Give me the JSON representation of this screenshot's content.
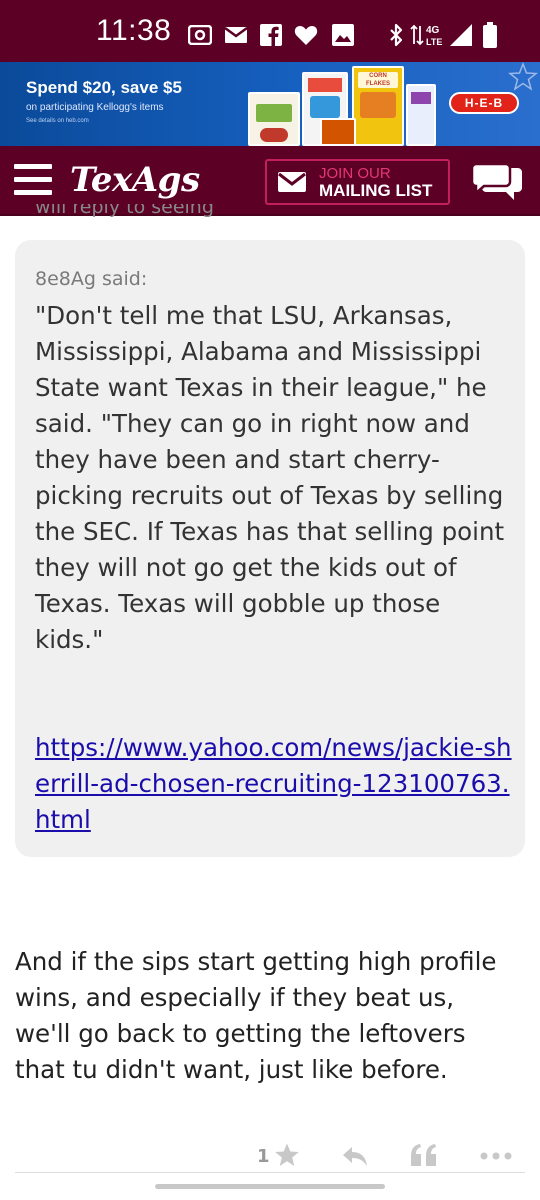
{
  "status_bar": {
    "time": "11:38",
    "icons": [
      "screen-record-icon",
      "mail-icon",
      "facebook-icon",
      "heart-icon",
      "image-icon",
      "bluetooth-icon",
      "4g-lte-icon",
      "signal-icon",
      "battery-icon"
    ],
    "network_label_top": "4G",
    "network_label_bottom": "LTE"
  },
  "ad": {
    "headline": "Spend $20, save $5",
    "subline": "on participating Kellogg's items",
    "details": "See details on heb.com",
    "brand": "H-E-B",
    "product_label": "CORN FLAKES"
  },
  "header": {
    "logo": "TexAgs",
    "mailing_line1": "JOIN OUR",
    "mailing_line2": "MAILING LIST"
  },
  "post": {
    "peek_text": "will reply to seeing",
    "quote_author": "8e8Ag said:",
    "quote_body": "\"Don't tell me that LSU, Arkansas, Mississippi, Alabama and Mississippi State want Texas in their league,\" he said. \"They can go in right now and they have been and start cherry-picking recruits out of Texas by selling the SEC. If Texas has that selling point they will not go get the kids out of Texas. Texas will gobble up those kids.\"",
    "quote_link": "https://www.yahoo.com/news/jackie-sherrill-ad-chosen-recruiting-123100763.html",
    "reply_body": "And if the sips start getting high profile wins, and especially if they beat us, we'll go back to getting the leftovers that tu didn't want, just like before.",
    "like_count": "1"
  },
  "colors": {
    "maroon": "#5c0025",
    "accent_pink": "#e23873",
    "link_blue": "#1a0dab",
    "quote_bg": "#f0f0f0",
    "ad_blue": "#1660bf",
    "heb_red": "#e2231a"
  }
}
